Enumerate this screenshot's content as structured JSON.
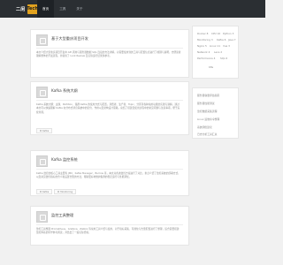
{
  "brand": {
    "name": "二闲",
    "badge": "Tech"
  },
  "nav": [
    {
      "label": "首页"
    },
    {
      "label": "工具"
    },
    {
      "label": "关于"
    }
  ],
  "posts": [
    {
      "title": "基于大型重庆项目开发",
      "excerpt": "本文介绍大型重庆项目开发中 API 调用与服务器数据 SQL 连接的方法详解。对需要使用到的工具与配置信息进行了梳理与说明，方便读者理解整体的开发流程，并提供了 Lock Review 及实际运行结果供参考。",
      "tags": []
    },
    {
      "title": "Kafka 系统大纲",
      "excerpt": "Kafka 系统大纲：主题、Partition、集群 Kafka 的使用方式与配置，消费者、生产者、Topic、分区等各种常用功能的实践与讲解。通过本文可以快速理解 Kafka 在分布式消息系统中的定位、作用以及架构设计思路，总结了搭建及使用过程中的常见问题与注意事项，便于后续查阅。",
      "tags": [
        {
          "label": "Kafka"
        }
      ]
    },
    {
      "title": "Kafka 监控系统",
      "excerpt": "Kafka 监控的核心工具主要有 JMX、Kafka Manager、Burrow 等，本文对各类监控方案进行了对比，重点介绍了监控系统的部署方式，以及常见监控指标的含义和设置告警的方法，帮助更好地维护集群的稳定运行与性能调优。",
      "tags": [
        {
          "label": "Kafka"
        },
        {
          "label": "Monitoring"
        }
      ]
    },
    {
      "title": "监控工具整理",
      "excerpt": "监控工具整理 Prometheus、Grafana、Zabbix 等常用工具介绍与使用，对于指标采集、可视化与告警配置进行了整理，适合需要搭建监控体系的同学参考阅读，并给出了一些实际经验。",
      "tags": []
    }
  ],
  "tag_cloud": [
    {
      "label": "Docker 8"
    },
    {
      "label": "CPU 10"
    },
    {
      "label": "Python 3"
    },
    {
      "label": "Monitoring 3"
    },
    {
      "label": "Kafka 6"
    },
    {
      "label": "Java 7"
    },
    {
      "label": "Nginx 5"
    },
    {
      "label": "Linux 11"
    },
    {
      "label": "Vue 3"
    },
    {
      "label": "Network 4"
    },
    {
      "label": "Lens 2"
    },
    {
      "label": "Performance 4"
    },
    {
      "label": "SQL 6"
    },
    {
      "label": "K8s"
    }
  ],
  "sidebar_list": [
    {
      "label": "服务器容量评估指南"
    },
    {
      "label": "服务器性能测试"
    },
    {
      "label": "监控数据采集流程"
    },
    {
      "label": "Linux 运维命令整理"
    },
    {
      "label": "系统调优建议"
    },
    {
      "label": "日志分析工具汇总"
    }
  ]
}
